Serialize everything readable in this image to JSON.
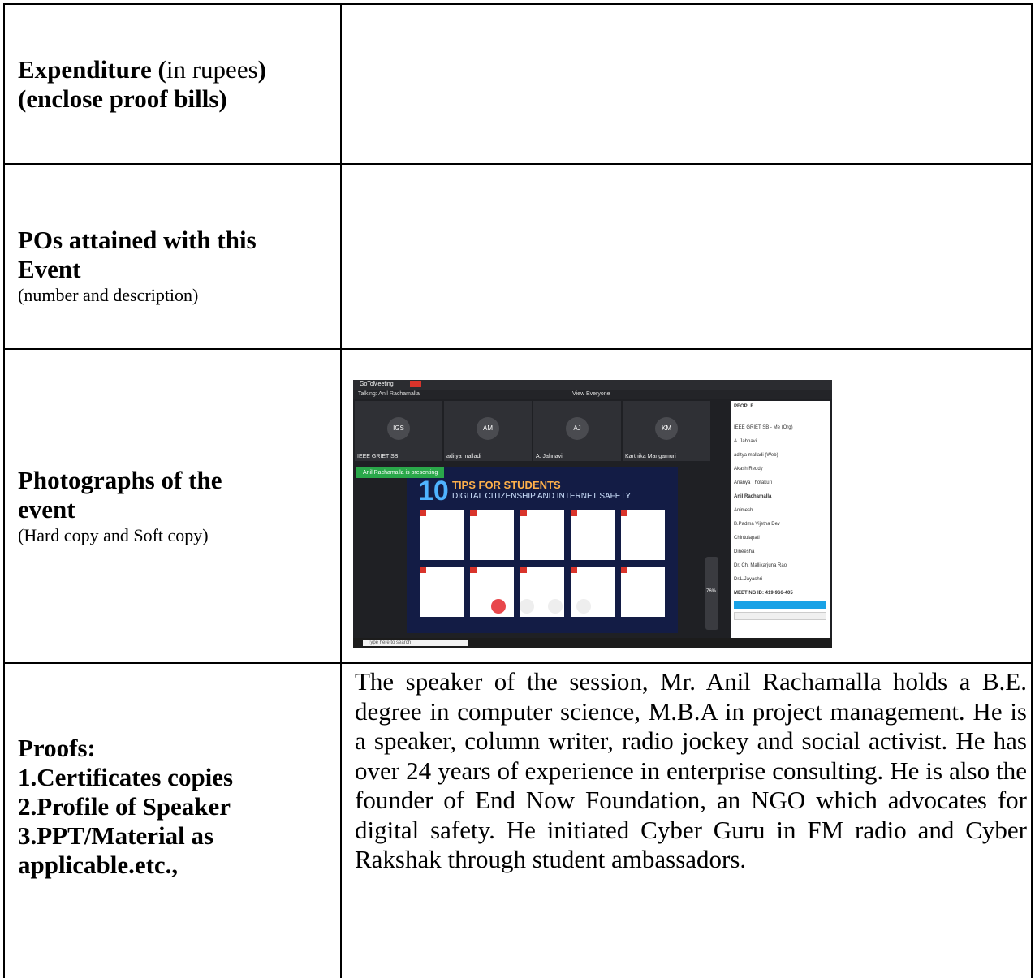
{
  "rows": {
    "expenditure": {
      "label_bold": "Expenditure (",
      "label_normal": "in rupees",
      "label_bold_end": ")",
      "line2": "(enclose proof bills)",
      "value": ""
    },
    "pos": {
      "line1": "POs attained with this",
      "line2": "Event",
      "note": "(number and description)",
      "value": ""
    },
    "photos": {
      "line1": "Photographs of the",
      "line2": "event",
      "note": "(Hard copy and Soft copy)"
    },
    "proofs": {
      "line1": "Proofs:",
      "line2": "1.Certificates copies",
      "line3": "2.Profile of Speaker",
      "line4": "3.PPT/Material as",
      "line5": "applicable.etc.,",
      "description": "The speaker of the session, Mr. Anil Rachamalla holds a B.E. degree in computer science, M.B.A in project management. He is a speaker, column writer, radio jockey and social activist. He has over 24 years of experience in enterprise consulting. He is also the founder of End Now Foundation, an NGO which advocates for digital safety. He initiated Cyber Guru in FM radio and Cyber Rakshak through student ambassadors."
    }
  },
  "screenshot": {
    "app": "GoToMeeting",
    "talking": "Talking: Anil Rachamalla",
    "view": "View Everyone",
    "tiles": [
      {
        "initials": "IGS",
        "name": "IEEE GRIET SB"
      },
      {
        "initials": "AM",
        "name": "aditya malladi"
      },
      {
        "initials": "AJ",
        "name": "A. Jahnavi"
      },
      {
        "initials": "KM",
        "name": "Karthika Mangamuri"
      }
    ],
    "presenting": "Anil Rachamalla is presenting",
    "slide_number": "10",
    "slide_title": "TIPS FOR STUDENTS",
    "slide_subtitle": "DIGITAL CITIZENSHIP AND INTERNET SAFETY",
    "zoom": "76%",
    "people_header": "PEOPLE",
    "people": [
      "IEEE GRIET SB - Me (Org)",
      "A. Jahnavi",
      "aditya malladi (Web)",
      "Akash Reddy",
      "Ananya Thotakuri",
      "Anil Rachamalla",
      "Animesh",
      "B.Padma Vijetha Dev",
      "Chintulapati",
      "Dineesha",
      "Dr. Ch. Mallikarjuna Rao",
      "Dr.L.Jayashri"
    ],
    "meeting_id": "MEETING ID: 419-966-405",
    "search_placeholder": "Type here to search"
  }
}
